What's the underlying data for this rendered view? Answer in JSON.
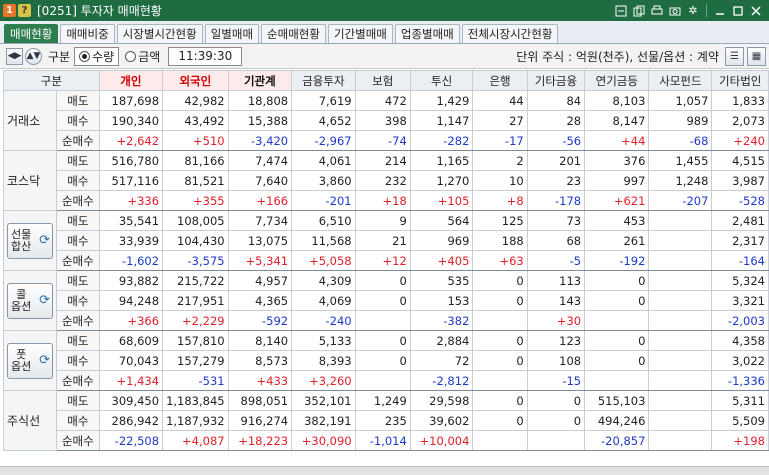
{
  "titlebar": {
    "badge_one": "1",
    "badge_q": "?",
    "title": "[0251] 투자자 매매현황"
  },
  "tabs": [
    {
      "label": "매매현황",
      "active": true
    },
    {
      "label": "매매비중",
      "active": false
    },
    {
      "label": "시장별시간현황",
      "active": false
    },
    {
      "label": "일별매매",
      "active": false
    },
    {
      "label": "순매매현황",
      "active": false
    },
    {
      "label": "기간별매매",
      "active": false
    },
    {
      "label": "업종별매매",
      "active": false
    },
    {
      "label": "전체시장시간현황",
      "active": false
    }
  ],
  "controls": {
    "gubun_label": "구분",
    "radio_qty": "수량",
    "radio_amt": "금액",
    "time": "11:39:30",
    "unit_text": "단위 주식 : 억원(천주), 선물/옵션 : 계약"
  },
  "table": {
    "headers": [
      "구분",
      "개인",
      "외국인",
      "기관계",
      "금융투자",
      "보험",
      "투신",
      "은행",
      "기타금융",
      "연기금등",
      "사모펀드",
      "기타법인"
    ],
    "groups": [
      {
        "name": "거래소",
        "button": false,
        "rows": [
          {
            "label": "매도",
            "values": [
              "187,698",
              "42,982",
              "18,808",
              "7,619",
              "472",
              "1,429",
              "44",
              "84",
              "8,103",
              "1,057",
              "1,833"
            ]
          },
          {
            "label": "매수",
            "values": [
              "190,340",
              "43,492",
              "15,388",
              "4,652",
              "398",
              "1,147",
              "27",
              "28",
              "8,147",
              "989",
              "2,073"
            ]
          },
          {
            "label": "순매수",
            "values": [
              "+2,642",
              "+510",
              "-3,420",
              "-2,967",
              "-74",
              "-282",
              "-17",
              "-56",
              "+44",
              "-68",
              "+240"
            ]
          }
        ]
      },
      {
        "name": "코스닥",
        "button": false,
        "rows": [
          {
            "label": "매도",
            "values": [
              "516,780",
              "81,166",
              "7,474",
              "4,061",
              "214",
              "1,165",
              "2",
              "201",
              "376",
              "1,455",
              "4,515"
            ]
          },
          {
            "label": "매수",
            "values": [
              "517,116",
              "81,521",
              "7,640",
              "3,860",
              "232",
              "1,270",
              "10",
              "23",
              "997",
              "1,248",
              "3,987"
            ]
          },
          {
            "label": "순매수",
            "values": [
              "+336",
              "+355",
              "+166",
              "-201",
              "+18",
              "+105",
              "+8",
              "-178",
              "+621",
              "-207",
              "-528"
            ]
          }
        ]
      },
      {
        "name": "선물\n합산",
        "button": true,
        "rows": [
          {
            "label": "매도",
            "values": [
              "35,541",
              "108,005",
              "7,734",
              "6,510",
              "9",
              "564",
              "125",
              "73",
              "453",
              "",
              "2,481"
            ]
          },
          {
            "label": "매수",
            "values": [
              "33,939",
              "104,430",
              "13,075",
              "11,568",
              "21",
              "969",
              "188",
              "68",
              "261",
              "",
              "2,317"
            ]
          },
          {
            "label": "순매수",
            "values": [
              "-1,602",
              "-3,575",
              "+5,341",
              "+5,058",
              "+12",
              "+405",
              "+63",
              "-5",
              "-192",
              "",
              "-164"
            ]
          }
        ]
      },
      {
        "name": "콜\n옵션",
        "button": true,
        "rows": [
          {
            "label": "매도",
            "values": [
              "93,882",
              "215,722",
              "4,957",
              "4,309",
              "0",
              "535",
              "0",
              "113",
              "0",
              "",
              "5,324"
            ]
          },
          {
            "label": "매수",
            "values": [
              "94,248",
              "217,951",
              "4,365",
              "4,069",
              "0",
              "153",
              "0",
              "143",
              "0",
              "",
              "3,321"
            ]
          },
          {
            "label": "순매수",
            "values": [
              "+366",
              "+2,229",
              "-592",
              "-240",
              "",
              "-382",
              "",
              "+30",
              "",
              "",
              "-2,003"
            ]
          }
        ]
      },
      {
        "name": "풋\n옵션",
        "button": true,
        "rows": [
          {
            "label": "매도",
            "values": [
              "68,609",
              "157,810",
              "8,140",
              "5,133",
              "0",
              "2,884",
              "0",
              "123",
              "0",
              "",
              "4,358"
            ]
          },
          {
            "label": "매수",
            "values": [
              "70,043",
              "157,279",
              "8,573",
              "8,393",
              "0",
              "72",
              "0",
              "108",
              "0",
              "",
              "3,022"
            ]
          },
          {
            "label": "순매수",
            "values": [
              "+1,434",
              "-531",
              "+433",
              "+3,260",
              "",
              "-2,812",
              "",
              "-15",
              "",
              "",
              "-1,336"
            ]
          }
        ]
      },
      {
        "name": "주식선",
        "button": false,
        "rows": [
          {
            "label": "매도",
            "values": [
              "309,450",
              "1,183,845",
              "898,051",
              "352,101",
              "1,249",
              "29,598",
              "0",
              "0",
              "515,103",
              "",
              "5,311"
            ]
          },
          {
            "label": "매수",
            "values": [
              "286,942",
              "1,187,932",
              "916,274",
              "382,191",
              "235",
              "39,602",
              "0",
              "0",
              "494,246",
              "",
              "5,509"
            ]
          },
          {
            "label": "순매수",
            "values": [
              "-22,508",
              "+4,087",
              "+18,223",
              "+30,090",
              "-1,014",
              "+10,004",
              "",
              "",
              "-20,857",
              "",
              "+198"
            ]
          }
        ]
      }
    ]
  },
  "colors": {
    "titlebar": "#1f6b42",
    "active_tab": "#2e7d4f",
    "positive": "#e0202a",
    "negative": "#1d39c9"
  }
}
